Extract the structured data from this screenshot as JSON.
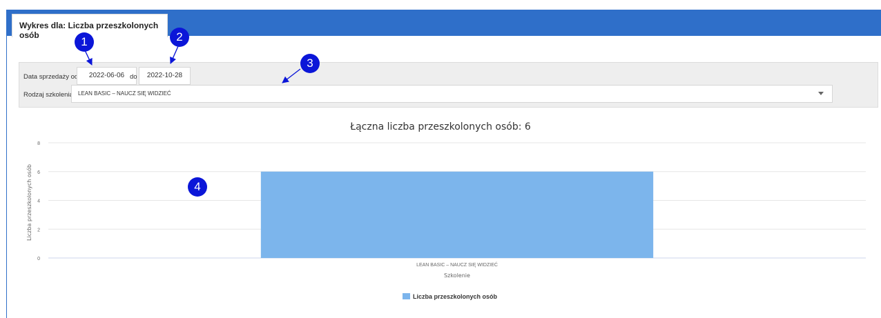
{
  "tab": {
    "title": "Wykres dla: Liczba przeszkolonych osób"
  },
  "filters": {
    "date_label_from": "Data sprzedaży od",
    "date_from": "2022-06-06",
    "date_label_to": "do",
    "date_to": "2022-10-28",
    "training_type_label": "Rodzaj szkolenia",
    "training_type_value": "LEAN BASIC – NAUCZ SIĘ WIDZIEĆ"
  },
  "annotations": [
    "1",
    "2",
    "3",
    "4"
  ],
  "colors": {
    "header": "#2f6fc9",
    "bar": "#7cb5ec",
    "badge": "#0b16d8"
  },
  "chart_data": {
    "type": "bar",
    "title": "Łączna liczba przeszkolonych osób: 6",
    "categories": [
      "LEAN BASIC – NAUCZ SIĘ WIDZIEĆ"
    ],
    "series": [
      {
        "name": "Liczba przeszkolonych osób",
        "values": [
          6
        ]
      }
    ],
    "xlabel": "Szkolenie",
    "ylabel": "Liczba przeszkolonych osób",
    "ylim": [
      0,
      8
    ],
    "yticks": [
      0,
      2,
      4,
      6,
      8
    ],
    "grid": true,
    "legend": "bottom-center"
  }
}
